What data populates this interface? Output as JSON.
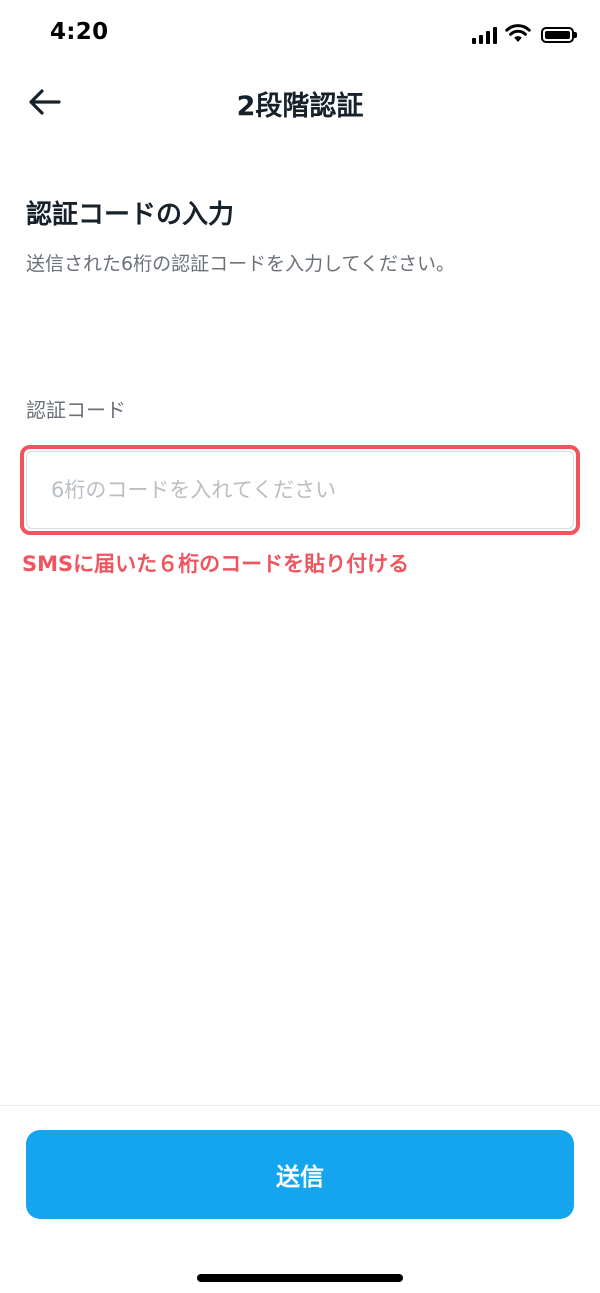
{
  "status_bar": {
    "time": "4:20",
    "icons": [
      "cellular-signal-icon",
      "wifi-icon",
      "battery-icon"
    ]
  },
  "nav": {
    "back_icon": "arrow-left-icon",
    "title": "2段階認証"
  },
  "content": {
    "heading": "認証コードの入力",
    "description": "送信された6桁の認証コードを入力してください。",
    "field_label": "認証コード",
    "input_value": "",
    "input_placeholder": "6桁のコードを入れてください",
    "annotation": "SMSに届いた６桁のコードを貼り付ける"
  },
  "footer": {
    "submit_label": "送信"
  },
  "colors": {
    "accent": "#14a5ee",
    "annotation": "#f0555f",
    "text_primary": "#17212b",
    "text_secondary": "#6b7178",
    "placeholder": "#b9bec3"
  }
}
